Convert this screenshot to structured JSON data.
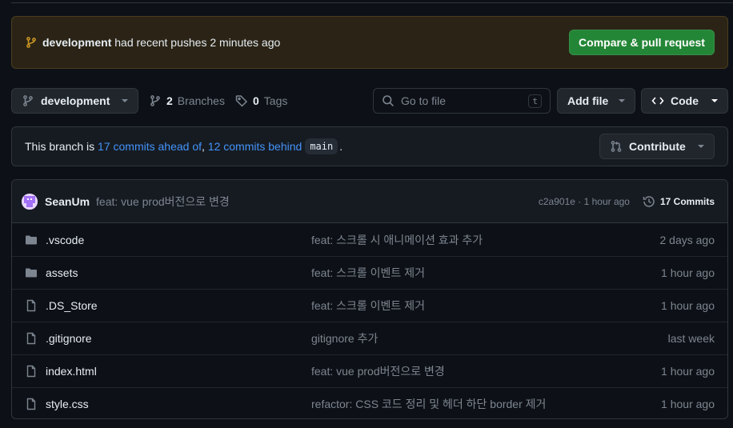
{
  "banner": {
    "branch": "development",
    "text": "had recent pushes 2 minutes ago",
    "button": "Compare & pull request"
  },
  "toolbar": {
    "branch_selector": "development",
    "branches_count": "2",
    "branches_label": "Branches",
    "tags_count": "0",
    "tags_label": "Tags",
    "search_placeholder": "Go to file",
    "search_shortcut": "t",
    "add_file": "Add file",
    "code": "Code"
  },
  "ahead_behind": {
    "prefix": "This branch is",
    "ahead": "17 commits ahead of",
    "sep": ",",
    "behind": "12 commits behind",
    "base": "main",
    "suffix": ".",
    "contribute": "Contribute"
  },
  "latest_commit": {
    "author": "SeanUm",
    "message": "feat: vue prod버전으로 변경",
    "sha_time": "c2a901e · 1 hour ago",
    "commits_label": "17 Commits"
  },
  "files": [
    {
      "type": "folder",
      "name": ".vscode",
      "message": "feat: 스크롤 시 애니메이션 효과 추가",
      "time": "2 days ago"
    },
    {
      "type": "folder",
      "name": "assets",
      "message": "feat: 스크롤 이벤트 제거",
      "time": "1 hour ago"
    },
    {
      "type": "file",
      "name": ".DS_Store",
      "message": "feat: 스크롤 이벤트 제거",
      "time": "1 hour ago"
    },
    {
      "type": "file",
      "name": ".gitignore",
      "message": "gitignore 추가",
      "time": "last week"
    },
    {
      "type": "file",
      "name": "index.html",
      "message": "feat: vue prod버전으로 변경",
      "time": "1 hour ago"
    },
    {
      "type": "file",
      "name": "style.css",
      "message": "refactor: CSS 코드 정리 및 헤더 하단 border 제거",
      "time": "1 hour ago"
    }
  ],
  "colors": {
    "accent_green": "#238636",
    "link_blue": "#4493f8",
    "banner_bg": "#2b2416"
  }
}
